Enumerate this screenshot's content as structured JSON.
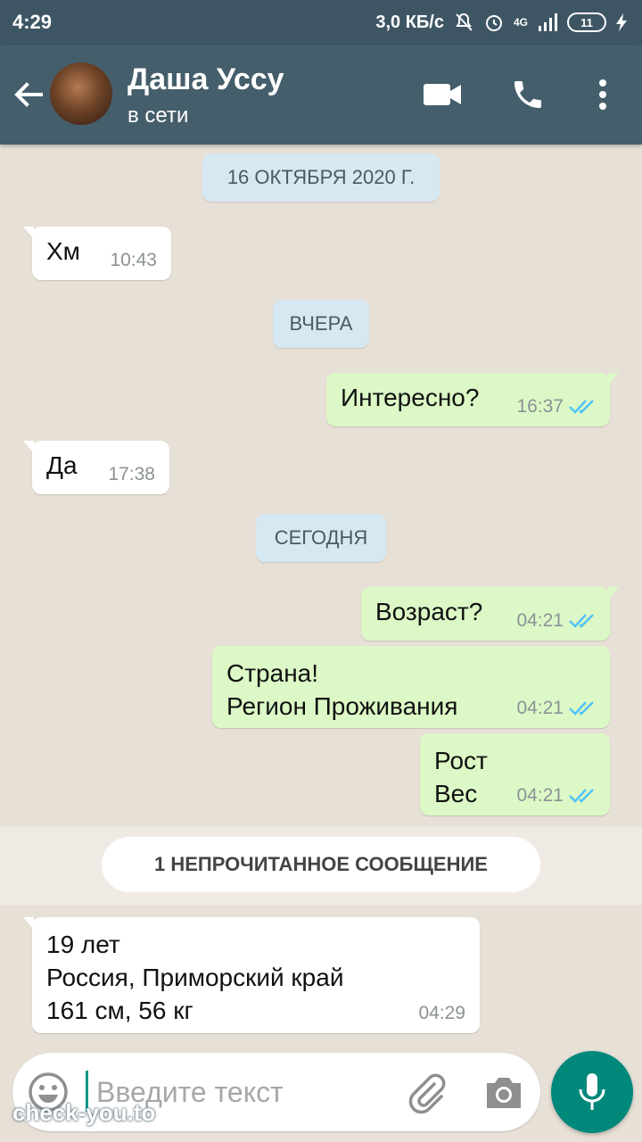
{
  "status_bar": {
    "time": "4:29",
    "speed": "3,0 КБ/с",
    "network": "4G",
    "battery": "11"
  },
  "header": {
    "contact_name": "Даша Уссу",
    "contact_status": "в сети"
  },
  "messages": [
    {
      "kind": "date",
      "text": "16 ОКТЯБРЯ 2020 Г."
    },
    {
      "kind": "in",
      "text": "Хм",
      "time": "10:43"
    },
    {
      "kind": "date",
      "text": "ВЧЕРА"
    },
    {
      "kind": "out",
      "text": "Интересно?",
      "time": "16:37"
    },
    {
      "kind": "in",
      "text": "Да",
      "time": "17:38"
    },
    {
      "kind": "date",
      "text": "СЕГОДНЯ"
    },
    {
      "kind": "out",
      "text": "Возраст?",
      "time": "04:21"
    },
    {
      "kind": "out",
      "text": "Страна!\nРегион Проживания",
      "time": "04:21"
    },
    {
      "kind": "out",
      "text": "Рост\nВес",
      "time": "04:21"
    },
    {
      "kind": "unread",
      "text": "1 НЕПРОЧИТАННОЕ СООБЩЕНИЕ"
    },
    {
      "kind": "in",
      "text": "19 лет\nРоссия, Приморский край\n161 см, 56 кг",
      "time": "04:29"
    }
  ],
  "composer": {
    "placeholder": "Введите текст"
  },
  "watermark": "check-you.to",
  "colors": {
    "header": "#455e6b",
    "outgoing_bubble": "#dcf8c6",
    "incoming_bubble": "#ffffff",
    "read_ticks": "#4fc3f7",
    "mic_button": "#00897b"
  }
}
